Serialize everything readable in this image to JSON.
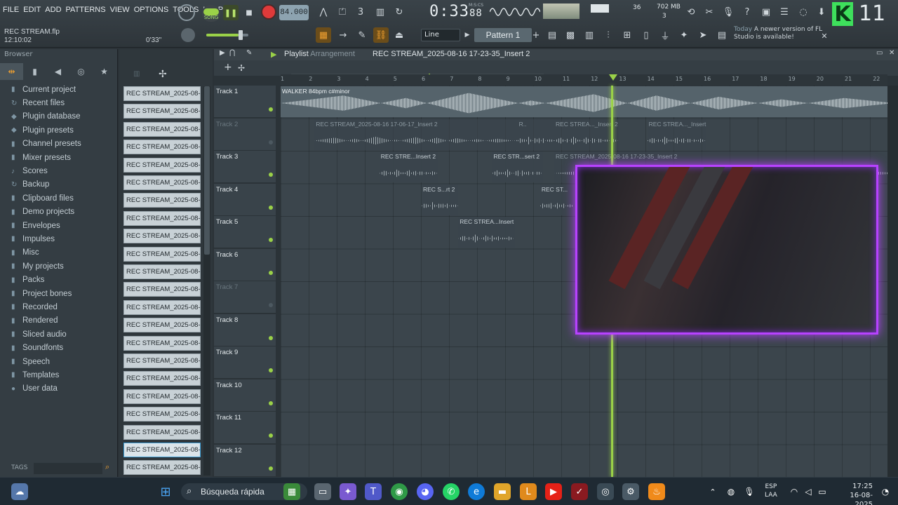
{
  "menu": [
    "FILE",
    "EDIT",
    "ADD",
    "PATTERNS",
    "VIEW",
    "OPTIONS",
    "TOOLS",
    "HELP"
  ],
  "transport": {
    "song_label": "SONG",
    "tempo": "84.000",
    "time_main": "0:33",
    "time_sub": "88",
    "time_unit": "M:S:CS"
  },
  "monitor": {
    "cpu": "36",
    "memory": "702 MB",
    "polyphony": "3"
  },
  "hint": {
    "file": "REC STREAM.flp",
    "clock": "12:10:02",
    "length": "0'33\""
  },
  "toolbar": {
    "snap": "Line",
    "pattern": "Pattern 1"
  },
  "news": {
    "today": "Today",
    "text": "A newer version of FL Studio is available!"
  },
  "brand": {
    "letter": "K",
    "count": "11"
  },
  "browser": {
    "title": "Browser",
    "items": [
      {
        "icon": "▮",
        "label": "Current project"
      },
      {
        "icon": "↻",
        "label": "Recent files"
      },
      {
        "icon": "◆",
        "label": "Plugin database"
      },
      {
        "icon": "◆",
        "label": "Plugin presets"
      },
      {
        "icon": "▮",
        "label": "Channel presets"
      },
      {
        "icon": "▮",
        "label": "Mixer presets"
      },
      {
        "icon": "♪",
        "label": "Scores"
      },
      {
        "icon": "↻",
        "label": "Backup"
      },
      {
        "icon": "▮",
        "label": "Clipboard files"
      },
      {
        "icon": "▮",
        "label": "Demo projects"
      },
      {
        "icon": "▮",
        "label": "Envelopes"
      },
      {
        "icon": "▮",
        "label": "Impulses"
      },
      {
        "icon": "▮",
        "label": "Misc"
      },
      {
        "icon": "▮",
        "label": "My projects"
      },
      {
        "icon": "▮",
        "label": "Packs"
      },
      {
        "icon": "▮",
        "label": "Project bones"
      },
      {
        "icon": "▮",
        "label": "Recorded"
      },
      {
        "icon": "▮",
        "label": "Rendered"
      },
      {
        "icon": "▮",
        "label": "Sliced audio"
      },
      {
        "icon": "▮",
        "label": "Soundfonts"
      },
      {
        "icon": "▮",
        "label": "Speech"
      },
      {
        "icon": "▮",
        "label": "Templates"
      },
      {
        "icon": "●",
        "label": "User data"
      }
    ],
    "tags_label": "TAGS"
  },
  "clips": [
    "REC STREAM_2025-08-16...",
    "REC STREAM_2025-08-16...",
    "REC STREAM_2025-08-16...",
    "REC STREAM_2025-08-16...",
    "REC STREAM_2025-08-16...",
    "REC STREAM_2025-08-16...",
    "REC STREAM_2025-08-16...",
    "REC STREAM_2025-08-16...",
    "REC STREAM_2025-08-16...",
    "REC STREAM_2025-08-16...",
    "REC STREAM_2025-08-16...",
    "REC STREAM_2025-08-16...",
    "REC STREAM_2025-08-16...",
    "REC STREAM_2025-08-16...",
    "REC STREAM_2025-08-16...",
    "REC STREAM_2025-08-16...",
    "REC STREAM_2025-08-16...",
    "REC STREAM_2025-08-16...",
    "REC STREAM_2025-08-16...",
    "REC STREAM_2025-08-16...",
    "REC STREAM_2025-08-16...",
    "REC STREAM_2025-08-16..."
  ],
  "playlist": {
    "title": "Playlist",
    "subtitle": "Arrangement",
    "sequence": "REC STREAM_2025-08-16 17-23-35_Insert 2",
    "ruler": [
      "1",
      "2",
      "3",
      "4",
      "5",
      "6",
      "7",
      "8",
      "9",
      "10",
      "11",
      "12",
      "13",
      "14",
      "15",
      "16",
      "17",
      "18",
      "19",
      "20",
      "21",
      "22"
    ],
    "tracks": [
      {
        "name": "Track 1",
        "active": true
      },
      {
        "name": "Track 2",
        "active": false
      },
      {
        "name": "Track 3",
        "active": true
      },
      {
        "name": "Track 4",
        "active": true
      },
      {
        "name": "Track 5",
        "active": true
      },
      {
        "name": "Track 6",
        "active": true
      },
      {
        "name": "Track 7",
        "active": false
      },
      {
        "name": "Track 8",
        "active": true
      },
      {
        "name": "Track 9",
        "active": true
      },
      {
        "name": "Track 10",
        "active": true
      },
      {
        "name": "Track 11",
        "active": true
      },
      {
        "name": "Track 12",
        "active": true
      }
    ],
    "audio_clips": [
      {
        "label": "WALKER 84bpm c#minor",
        "track": 0,
        "start": 0,
        "end": 22.2,
        "kind": "main"
      },
      {
        "label": "REC STREAM_2025-08-16 17-06-17_Insert 2",
        "track": 1,
        "start": 1.2,
        "end": 8.4,
        "kind": "ghost"
      },
      {
        "label": "R..",
        "track": 1,
        "start": 8.4,
        "end": 9.7,
        "kind": "ghost"
      },
      {
        "label": "REC STREA..._Insert 2",
        "track": 1,
        "start": 9.7,
        "end": 12.0,
        "kind": "ghost"
      },
      {
        "label": "REC STREA..._Insert 2",
        "track": 1,
        "start": 13.0,
        "end": 15.1,
        "kind": "ghost"
      },
      {
        "label": "REC STRE...Insert 2",
        "track": 2,
        "start": 3.5,
        "end": 5.6,
        "kind": "normal"
      },
      {
        "label": "REC STR...sert 2",
        "track": 2,
        "start": 7.5,
        "end": 9.3,
        "kind": "normal"
      },
      {
        "label": "REC STREAM_2025-08-16 17-23-35_Insert 2",
        "track": 2,
        "start": 9.7,
        "end": 22.2,
        "kind": "ghost"
      },
      {
        "label": "REC S...rt 2",
        "track": 3,
        "start": 5.0,
        "end": 6.3,
        "kind": "normal"
      },
      {
        "label": "REC ST...",
        "track": 3,
        "start": 9.2,
        "end": 10.4,
        "kind": "normal"
      },
      {
        "label": "REC STREA...Insert 2",
        "track": 4,
        "start": 6.3,
        "end": 8.3,
        "kind": "normal"
      }
    ]
  },
  "taskbar": {
    "search": "Búsqueda rápida",
    "lang": "ESP",
    "region": "LAA",
    "time": "17:25",
    "date": "16-08-2025"
  }
}
